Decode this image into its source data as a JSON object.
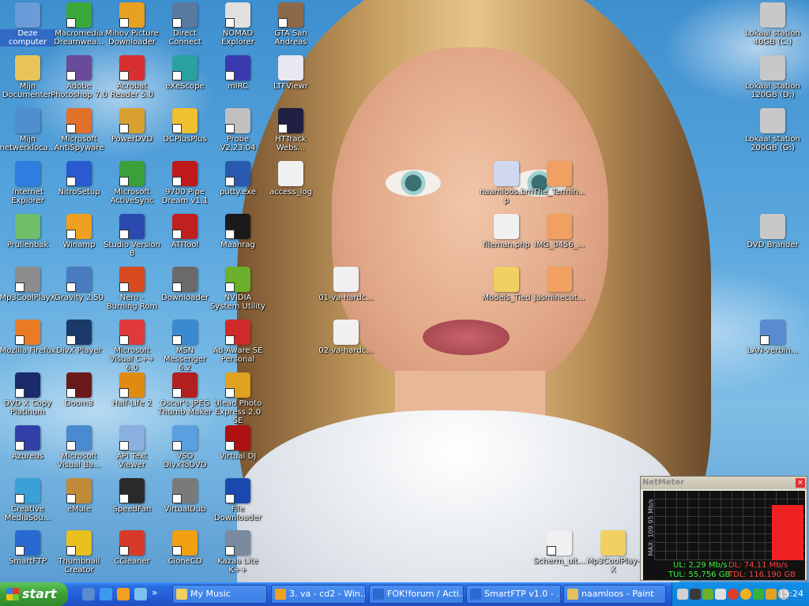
{
  "desktop_icons": [
    {
      "label": "Deze computer",
      "color": "#6b9bd8",
      "sc": false,
      "sel": true
    },
    {
      "label": "Mijn Documenten",
      "color": "#e8c35a",
      "sc": false
    },
    {
      "label": "Mijn netwerkloca...",
      "color": "#4f8fd0",
      "sc": false
    },
    {
      "label": "Internet Explorer",
      "color": "#2f7ee0",
      "sc": false
    },
    {
      "label": "Prullenbak",
      "color": "#6fbf6a",
      "sc": false
    },
    {
      "label": "Mp3CoolPlayX",
      "color": "#8c8c8c",
      "sc": true
    },
    {
      "label": "Mozilla Firefox",
      "color": "#e87b24",
      "sc": true
    },
    {
      "label": "DVD X Copy Platinum",
      "color": "#1a2a6a",
      "sc": true
    },
    {
      "label": "Azureus",
      "color": "#3040a8",
      "sc": true
    },
    {
      "label": "Creative MediaSou...",
      "color": "#3aa0d8",
      "sc": true
    },
    {
      "label": "SmartFTP",
      "color": "#2a6ad0",
      "sc": true
    },
    {
      "label": "Macromedia Dreamwea...",
      "color": "#3aa83a",
      "sc": true
    },
    {
      "label": "Adobe Photoshop 7.0",
      "color": "#6a4a9a",
      "sc": true
    },
    {
      "label": "Microsoft AntiSpyware",
      "color": "#e0702a",
      "sc": true
    },
    {
      "label": "NitroSetup",
      "color": "#2a5ad0",
      "sc": true
    },
    {
      "label": "Winamp",
      "color": "#f0a020",
      "sc": true
    },
    {
      "label": "Gravity 2.50",
      "color": "#4a7ac0",
      "sc": true
    },
    {
      "label": "DivX Player",
      "color": "#1a3a6a",
      "sc": true
    },
    {
      "label": "Doom3",
      "color": "#6a1a1a",
      "sc": true
    },
    {
      "label": "Microsoft Visual Ba...",
      "color": "#4a8ad0",
      "sc": true
    },
    {
      "label": "eMule",
      "color": "#c08a3a",
      "sc": true
    },
    {
      "label": "Thumbnail Creator",
      "color": "#e8c020",
      "sc": true
    },
    {
      "label": "Mihov Picture Downloader",
      "color": "#e8a020",
      "sc": true
    },
    {
      "label": "Acrobat Reader 5.0",
      "color": "#d83030",
      "sc": true
    },
    {
      "label": "PowerDVD",
      "color": "#d8a030",
      "sc": true
    },
    {
      "label": "Microsoft ActiveSync",
      "color": "#3aa03a",
      "sc": true
    },
    {
      "label": "Studio Version 8",
      "color": "#2a4ab0",
      "sc": true
    },
    {
      "label": "Nero - Burning Rom",
      "color": "#d84a20",
      "sc": true
    },
    {
      "label": "Microsoft Visual C++ 6.0",
      "color": "#e03a3a",
      "sc": true
    },
    {
      "label": "Half-Life 2",
      "color": "#e08a10",
      "sc": true
    },
    {
      "label": "API Text Viewer",
      "color": "#8ab0e0",
      "sc": true
    },
    {
      "label": "SpeedFan",
      "color": "#2a2a2a",
      "sc": true
    },
    {
      "label": "CCleaner",
      "color": "#d83a2a",
      "sc": true
    },
    {
      "label": "Direct Connect",
      "color": "#5a7aa0",
      "sc": true
    },
    {
      "label": "eXeScope",
      "color": "#2aa0a0",
      "sc": true
    },
    {
      "label": "DCPlusPlus",
      "color": "#f0c030",
      "sc": true
    },
    {
      "label": "9700 Pipe Dream v1.1",
      "color": "#c01a1a",
      "sc": true
    },
    {
      "label": "ATITool",
      "color": "#c02020",
      "sc": true
    },
    {
      "label": "Downloader",
      "color": "#6a6a6a",
      "sc": true
    },
    {
      "label": "MSN Messenger 6.2",
      "color": "#3a8ad0",
      "sc": true
    },
    {
      "label": "Oscar's JPEG Thumb Maker",
      "color": "#b02020",
      "sc": true
    },
    {
      "label": "VSO DivxToDVD",
      "color": "#5aa0e0",
      "sc": true
    },
    {
      "label": "VirtualDub",
      "color": "#7a7a7a",
      "sc": true
    },
    {
      "label": "CloneCD",
      "color": "#f0a010",
      "sc": true
    },
    {
      "label": "NOMAD Explorer",
      "color": "#e0e0e0",
      "sc": true
    },
    {
      "label": "mIRC",
      "color": "#3a3ab0",
      "sc": true
    },
    {
      "label": "Probe V2.23.04",
      "color": "#c0c0c0",
      "sc": true
    },
    {
      "label": "putty.exe",
      "color": "#2a5ab0",
      "sc": true
    },
    {
      "label": "Maanrag",
      "color": "#1a1a1a",
      "sc": true
    },
    {
      "label": "NVIDIA System Utility",
      "color": "#6ab02a",
      "sc": true
    },
    {
      "label": "Ad-Aware SE Personal",
      "color": "#d02a2a",
      "sc": true
    },
    {
      "label": "Ulead Photo Express 2.0 SE",
      "color": "#e0a020",
      "sc": true
    },
    {
      "label": "Virtual DJ",
      "color": "#b01010",
      "sc": true
    },
    {
      "label": "File Downloader",
      "color": "#1a4ab0",
      "sc": true
    },
    {
      "label": "Kazaa Lite K++",
      "color": "#7a8aa0",
      "sc": true
    },
    {
      "label": "GTA San Andreas",
      "color": "#8a6a4a",
      "sc": true
    },
    {
      "label": "LTFViewr",
      "color": "#e8e8f0",
      "sc": false
    },
    {
      "label": "HTTrack Webs...",
      "color": "#202040",
      "sc": true
    },
    {
      "label": "access_log",
      "color": "#f0f0f0",
      "sc": false
    },
    {
      "label": "01-va-hardc...",
      "color": "#f0f0f0",
      "sc": false
    },
    {
      "label": "02-va-hardc...",
      "color": "#f0f0f0",
      "sc": false
    },
    {
      "label": "naamloos.bmp",
      "color": "#d0d8f0",
      "sc": false
    },
    {
      "label": "fileman.php",
      "color": "#f0f0f0",
      "sc": false
    },
    {
      "label": "Models_Tied",
      "color": "#f0d060",
      "sc": false
    },
    {
      "label": "The_Termin...",
      "color": "#f0a060",
      "sc": false
    },
    {
      "label": "IMG_0456_...",
      "color": "#f0a060",
      "sc": false
    },
    {
      "label": "jasminecut...",
      "color": "#f0a060",
      "sc": false
    },
    {
      "label": "Scherm_uit...",
      "color": "#f0f0f0",
      "sc": true
    },
    {
      "label": "Mp3CoolPlay-X",
      "color": "#f0d060",
      "sc": false
    },
    {
      "label": "Lokaal station 40GB (C:)",
      "color": "#c8c8c8",
      "sc": false
    },
    {
      "label": "Lokaal station 120GB (D:)",
      "color": "#c8c8c8",
      "sc": false
    },
    {
      "label": "Lokaal station 200GB (G:)",
      "color": "#c8c8c8",
      "sc": false
    },
    {
      "label": "DVD Brander",
      "color": "#c8c8c8",
      "sc": false
    },
    {
      "label": "LAN-verbin...",
      "color": "#5a8ad0",
      "sc": true
    }
  ],
  "netmeter": {
    "title": "NetMeter",
    "max_label": "MAX: 109.95 Mb/s",
    "ul": "UL: 2,29 Mb/s",
    "dl": "DL: 74,11 Mb/s",
    "tul": "TUL: 55,756 GB",
    "tdl": "TDL: 116,190 GB"
  },
  "taskbar": {
    "start_label": "start",
    "quicklaunch": [
      {
        "name": "show-desktop-icon",
        "color": "#5a8ad0"
      },
      {
        "name": "ie-quicklaunch-icon",
        "color": "#3a9af0"
      },
      {
        "name": "winamp-quicklaunch-icon",
        "color": "#f0a020"
      },
      {
        "name": "msn-quicklaunch-icon",
        "color": "#7ac0f0"
      }
    ],
    "chevron": "»",
    "tasks": [
      {
        "label": "My Music",
        "color": "#f0d060"
      },
      {
        "label": "3. va - cd2 - Win...",
        "color": "#f0a020"
      },
      {
        "label": "FOK!forum / Acti...",
        "color": "#2a6ad0"
      },
      {
        "label": "SmartFTP v1.0 - ...",
        "color": "#2a6ad0"
      },
      {
        "label": "naamloos - Paint",
        "color": "#e0c060"
      }
    ],
    "clock": "15:24"
  }
}
